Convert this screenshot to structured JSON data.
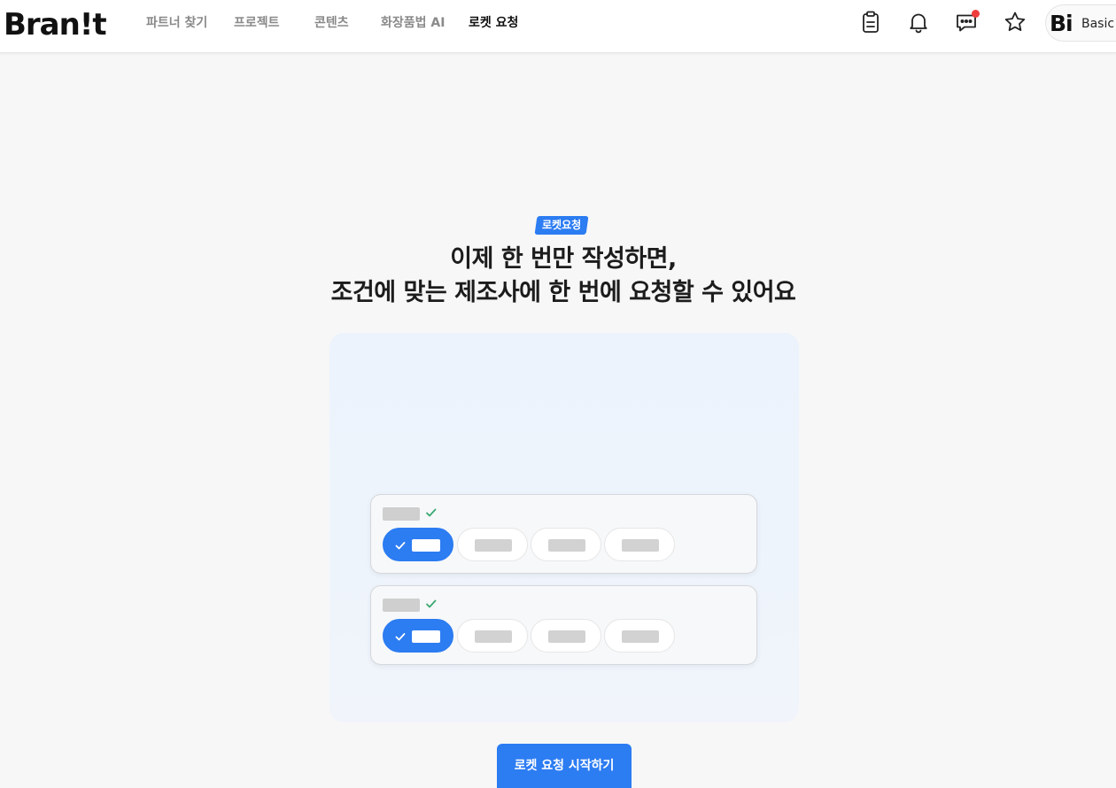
{
  "header": {
    "logo": "Bran!t",
    "nav": [
      {
        "label": "파트너 찾기"
      },
      {
        "label": "프로젝트"
      },
      {
        "label": "콘텐츠"
      },
      {
        "label": "화장품법 AI"
      },
      {
        "label": "로켓 요청"
      }
    ],
    "active_nav": "로켓 요청",
    "icons": [
      "clipboard-icon",
      "bell-icon",
      "chat-icon",
      "star-icon"
    ],
    "notification_dot_color": "#ef3d3d",
    "profile": {
      "mark": "Bi",
      "plan": "Basic"
    }
  },
  "hero": {
    "badge": "로켓요청",
    "headline_line1": "이제 한 번만 작성하면,",
    "headline_line2": "조건에 맞는 제조사에 한 번에 요청할 수 있어요"
  },
  "illustration": {
    "cards": [
      {
        "selected_chip": 1,
        "chip_count": 4
      },
      {
        "selected_chip": 1,
        "chip_count": 4
      }
    ]
  },
  "cta": {
    "label": "로켓 요청 시작하기"
  },
  "colors": {
    "accent": "#2c7cf2",
    "background": "#f7f7f7",
    "check_green": "#3aa872"
  }
}
